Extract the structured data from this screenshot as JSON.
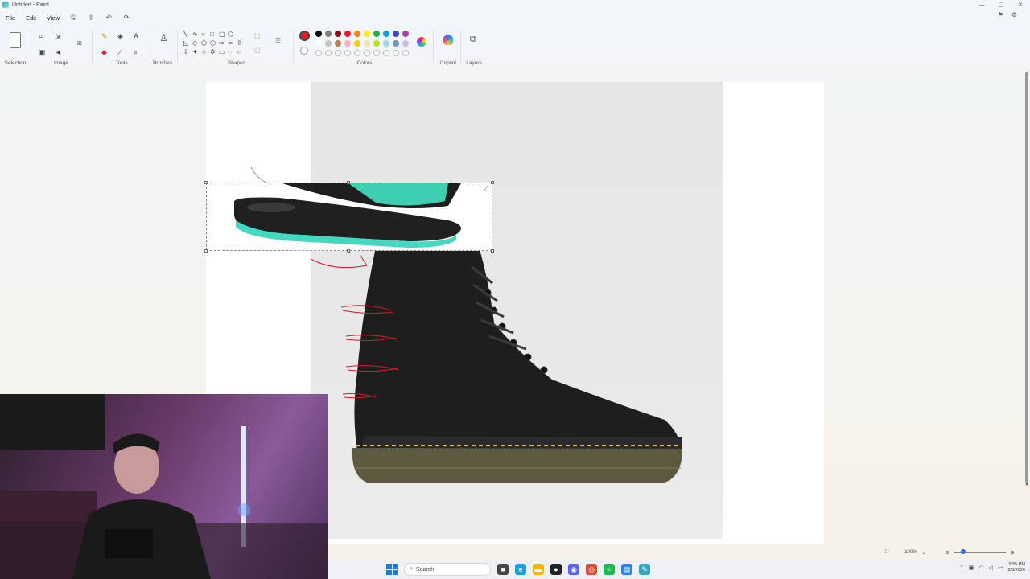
{
  "window": {
    "title": "Untitled - Paint",
    "controls": [
      "—",
      "▢",
      "✕"
    ]
  },
  "menu": {
    "file": "File",
    "edit": "Edit",
    "view": "View"
  },
  "ribbon": {
    "groups": {
      "selection": "Selection",
      "image": "Image",
      "tools": "Tools",
      "brushes": "Brushes",
      "shapes": "Shapes",
      "colors": "Colors",
      "copilot": "Copilot",
      "layers": "Layers"
    },
    "active_color": "#e0202a",
    "palette_row1": [
      "#000000",
      "#7f7f7f",
      "#880015",
      "#ed1c24",
      "#ff7f27",
      "#fff200",
      "#22b14c",
      "#00a2e8",
      "#3f48cc",
      "#a349a4"
    ],
    "palette_row2": [
      "#ffffff",
      "#c3c3c3",
      "#b97a57",
      "#ffaec9",
      "#ffc90e",
      "#efe4b0",
      "#b5e61d",
      "#99d9ea",
      "#7092be",
      "#c8bfe7"
    ]
  },
  "status": {
    "zoom": "100%"
  },
  "taskbar": {
    "search_placeholder": "Search",
    "time": "9:55 PM",
    "date": "2/3/2026"
  }
}
